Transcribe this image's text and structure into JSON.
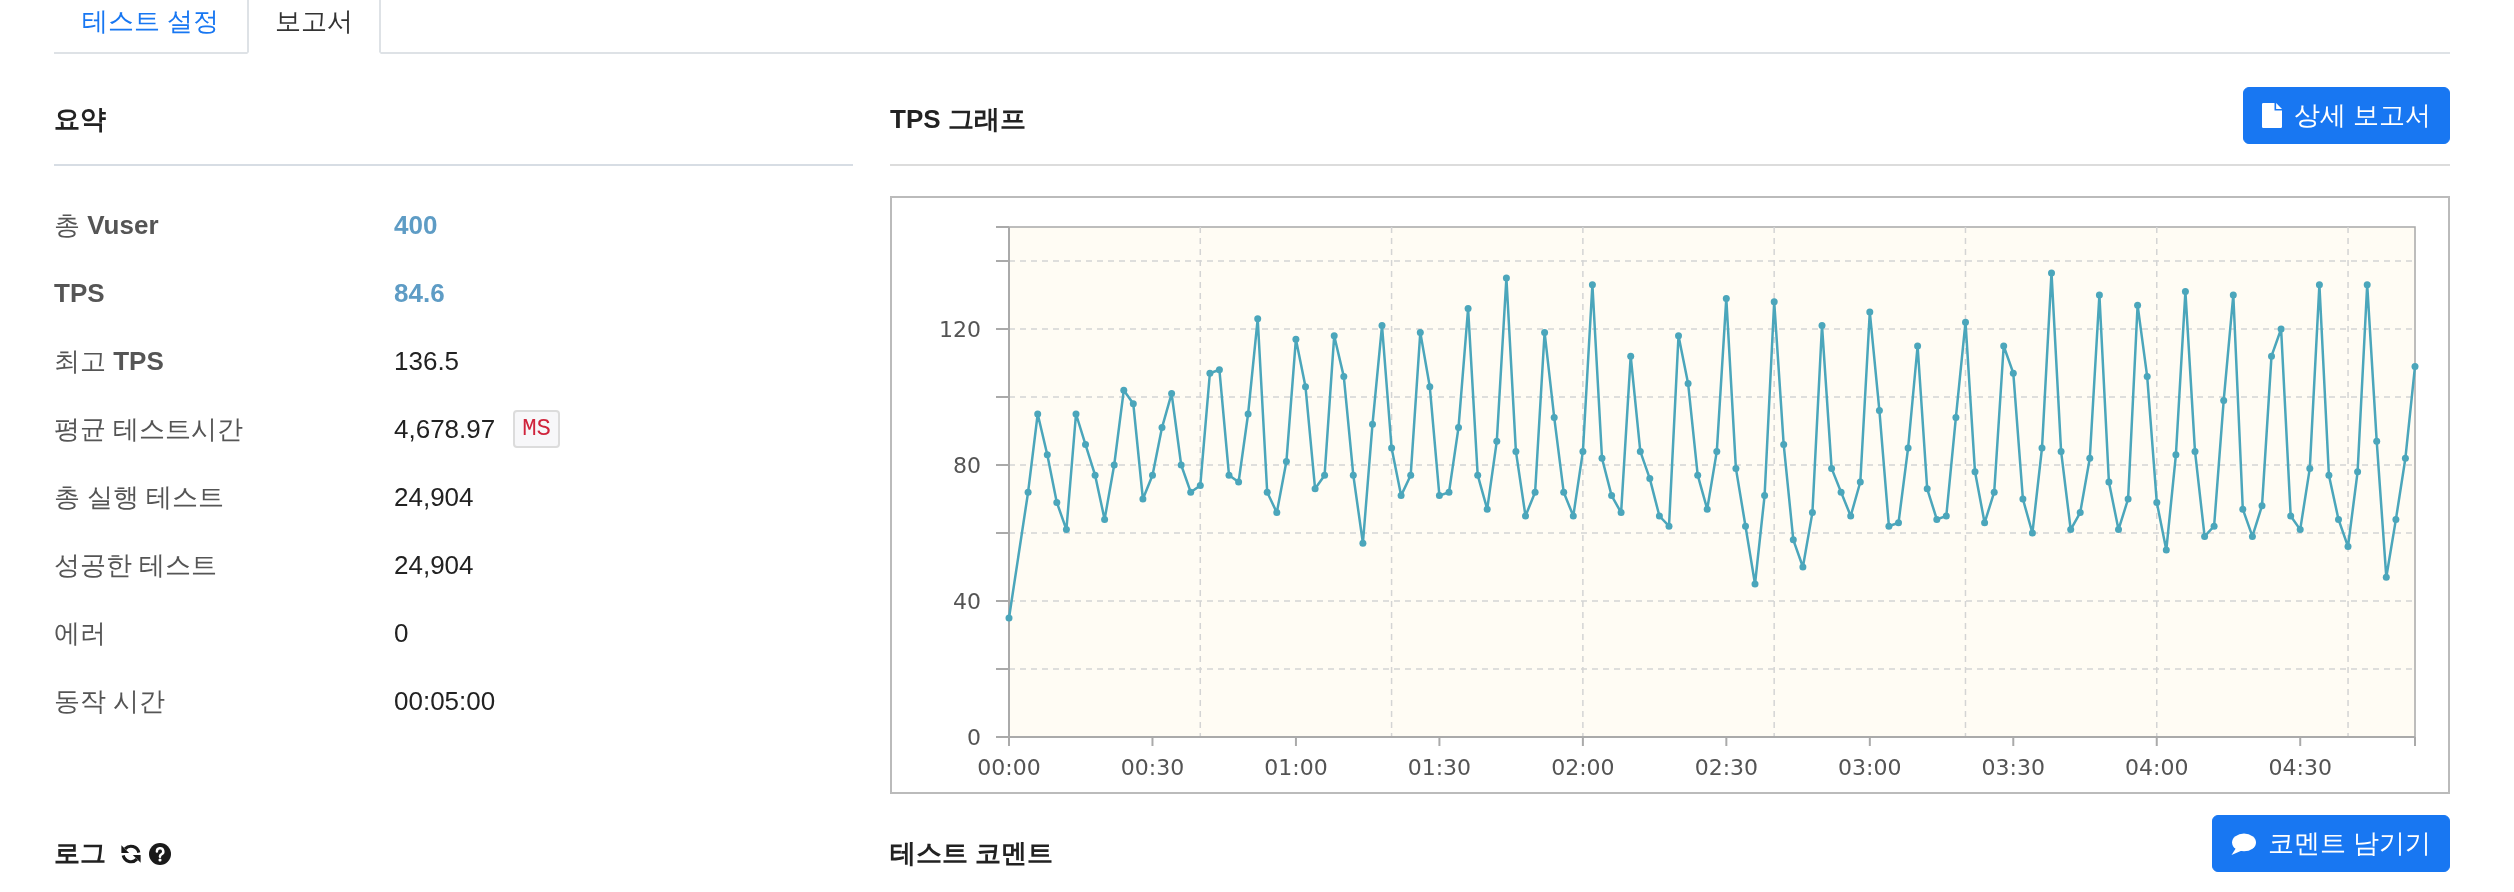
{
  "tabs": [
    {
      "label": "테스트 설정",
      "selected": false
    },
    {
      "label": "보고서",
      "selected": true
    }
  ],
  "summary": {
    "title": "요약",
    "rows": [
      {
        "label": "총 **Vuser**",
        "label_bold": false,
        "value": "400",
        "highlight": true
      },
      {
        "label": "TPS",
        "label_bold": true,
        "value": "84.6",
        "highlight": true
      },
      {
        "label": "최고 **TPS**",
        "label_bold": false,
        "value": "136.5",
        "highlight": false
      },
      {
        "label": "평균 테스트시간",
        "label_bold": false,
        "value": "4,678.97",
        "highlight": false,
        "unit": "MS"
      },
      {
        "label": "총 실행 테스트",
        "label_bold": false,
        "value": "24,904",
        "highlight": false
      },
      {
        "label": "성공한 테스트",
        "label_bold": false,
        "value": "24,904",
        "highlight": false
      },
      {
        "label": "에러",
        "label_bold": false,
        "value": "0",
        "highlight": false
      },
      {
        "label": "동작 시간",
        "label_bold": false,
        "value": "00:05:00",
        "highlight": false
      }
    ]
  },
  "tps_graph": {
    "title": "TPS 그래프",
    "button": "상세 보고서",
    "chart_data": {
      "type": "line",
      "grid": true,
      "x": [
        0,
        4,
        6,
        8,
        10,
        12,
        14,
        16,
        18,
        20,
        22,
        24,
        26,
        28,
        30,
        32,
        34,
        36,
        38,
        40,
        42,
        44,
        46,
        48,
        50,
        52,
        54,
        56,
        58,
        60,
        62,
        64,
        66,
        68,
        70,
        72,
        74,
        76,
        78,
        80,
        82,
        84,
        86,
        88,
        90,
        92,
        94,
        96,
        98,
        100,
        102,
        104,
        106,
        108,
        110,
        112,
        114,
        116,
        118,
        120,
        122,
        124,
        126,
        128,
        130,
        132,
        134,
        136,
        138,
        140,
        142,
        144,
        146,
        148,
        150,
        152,
        154,
        156,
        158,
        160,
        162,
        164,
        166,
        168,
        170,
        172,
        174,
        176,
        178,
        180,
        182,
        184,
        186,
        188,
        190,
        192,
        194,
        196,
        198,
        200,
        202,
        204,
        206,
        208,
        210,
        212,
        214,
        216,
        218,
        220,
        222,
        224,
        226,
        228,
        230,
        232,
        234,
        236,
        238,
        240,
        242,
        244,
        246,
        248,
        250,
        252,
        254,
        256,
        258,
        260,
        262,
        264,
        266,
        268,
        270,
        272,
        274,
        276,
        278,
        280,
        282,
        284,
        286,
        288,
        290,
        292,
        294
      ],
      "series": [
        {
          "color": "#4ba6bb",
          "marker": "circle",
          "values": [
            35,
            72,
            95,
            83,
            69,
            61,
            95,
            86,
            77,
            64,
            80,
            102,
            98,
            70,
            77,
            91,
            101,
            80,
            72,
            74,
            107,
            108,
            77,
            75,
            95,
            123,
            72,
            66,
            81,
            117,
            103,
            73,
            77,
            118,
            106,
            77,
            57,
            92,
            121,
            85,
            71,
            77,
            119,
            103,
            71,
            72,
            91,
            126,
            77,
            67,
            87,
            135,
            84,
            65,
            72,
            119,
            94,
            72,
            65,
            84,
            133,
            82,
            71,
            66,
            112,
            84,
            76,
            65,
            62,
            118,
            104,
            77,
            67,
            84,
            129,
            79,
            62,
            45,
            71,
            128,
            86,
            58,
            50,
            66,
            121,
            79,
            72,
            65,
            75,
            125,
            96,
            62,
            63,
            85,
            115,
            73,
            64,
            65,
            94,
            122,
            78,
            63,
            72,
            115,
            107,
            70,
            60,
            85,
            136.5,
            84,
            61,
            66,
            82,
            130,
            75,
            61,
            70,
            127,
            106,
            69,
            55,
            83,
            131,
            84,
            59,
            62,
            99,
            130,
            67,
            59,
            68,
            112,
            120,
            65,
            61,
            79,
            133,
            77,
            64,
            56,
            78,
            133,
            87,
            47,
            64,
            82,
            109
          ]
        }
      ],
      "xlim": [
        0,
        294
      ],
      "ylim": [
        0,
        150
      ],
      "xticks": [
        {
          "value": 0,
          "label": "00:00"
        },
        {
          "value": 30,
          "label": "00:30"
        },
        {
          "value": 60,
          "label": "01:00"
        },
        {
          "value": 90,
          "label": "01:30"
        },
        {
          "value": 120,
          "label": "02:00"
        },
        {
          "value": 150,
          "label": "02:30"
        },
        {
          "value": 180,
          "label": "03:00"
        },
        {
          "value": 210,
          "label": "03:30"
        },
        {
          "value": 240,
          "label": "04:00"
        },
        {
          "value": 270,
          "label": "04:30"
        }
      ],
      "yticks": [
        0,
        40,
        80,
        120
      ]
    }
  },
  "log": {
    "title": "로그"
  },
  "comments": {
    "title": "테스트 코멘트",
    "button": "코멘트 남기기"
  }
}
